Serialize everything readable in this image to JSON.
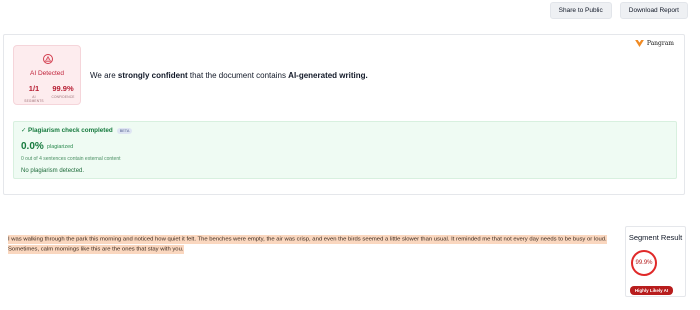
{
  "actions": {
    "share_label": "Share to Public",
    "download_label": "Download Report"
  },
  "brand": {
    "name": "Pangram",
    "icon": "pangram-logo-icon",
    "color": "#f08a24"
  },
  "ai_summary": {
    "title": "AI Detected",
    "icon": "warning-triangle-icon",
    "segments_value": "1/1",
    "segments_label": "AI SEGMENTS",
    "confidence_value": "99.9%",
    "confidence_label": "CONFIDENCE",
    "accent_color": "#c0223a"
  },
  "verdict": {
    "prefix": "We are ",
    "strength": "strongly confident",
    "middle": " that the document contains ",
    "result": "AI-generated writing."
  },
  "plagiarism": {
    "status": "✓ Plagiarism check completed",
    "beta_label": "BETA",
    "percent": "0.0%",
    "percent_label": "plagiarized",
    "sentences_text": "0 out of 4 sentences contain external content",
    "result_text": "No plagiarism detected."
  },
  "document": {
    "line1": "I was walking through the park this morning and noticed how quiet it felt. The benches were empty, the air was crisp, and even the birds seemed a little slower than usual. It reminded me that not every day needs to be busy or loud.",
    "line2": "Sometimes, calm mornings like this are the ones that stay with you.",
    "highlight_color": "#fad7bf"
  },
  "segment_result": {
    "title": "Segment Result",
    "score": "99.9%",
    "badge": "Highly Likely AI",
    "color": "#e02929"
  }
}
